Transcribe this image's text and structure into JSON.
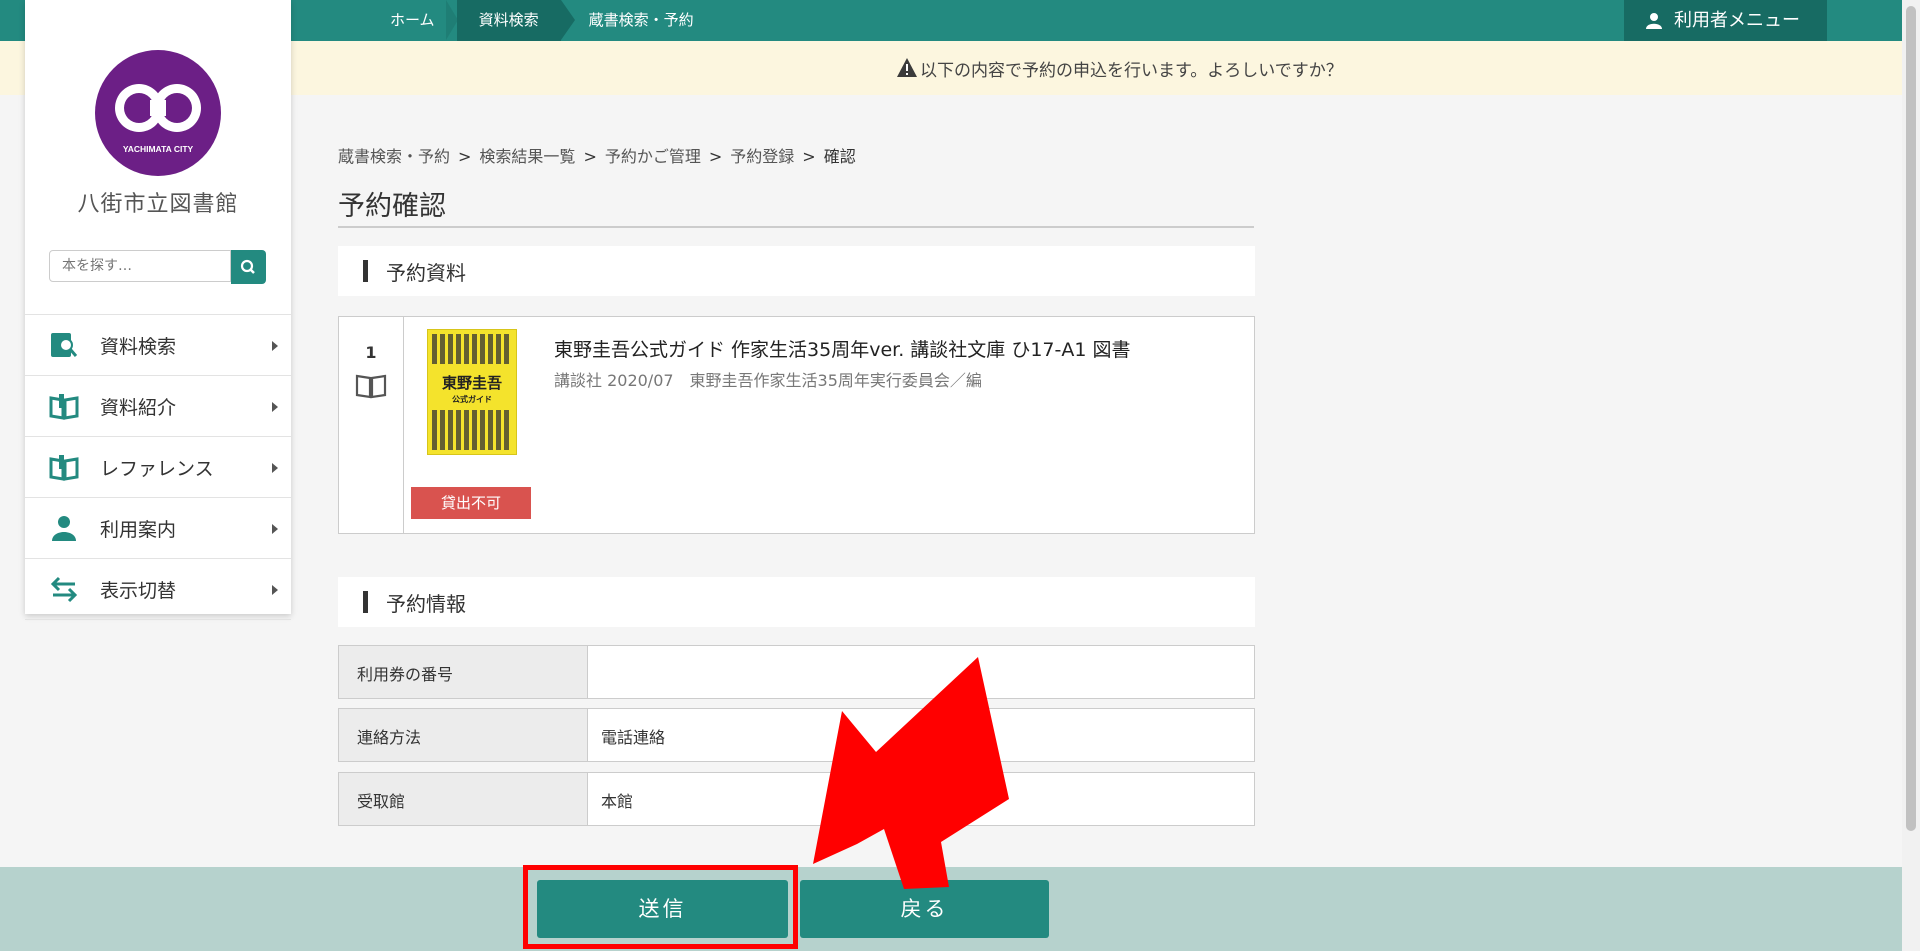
{
  "topnav": {
    "items": [
      "ホーム",
      "資料検索",
      "蔵書検索・予約"
    ],
    "user_menu": "利用者メニュー"
  },
  "warning": {
    "text": "以下の内容で予約の申込を行います。よろしいですか？"
  },
  "sidebar": {
    "logo_text": "YACHIMATA CITY",
    "library_name": "八街市立図書館",
    "search_placeholder": "本を探す…",
    "menu": [
      {
        "label": "資料検索",
        "icon": "book-search-icon"
      },
      {
        "label": "資料紹介",
        "icon": "open-book-icon"
      },
      {
        "label": "レファレンス",
        "icon": "open-book-icon"
      },
      {
        "label": "利用案内",
        "icon": "person-icon"
      },
      {
        "label": "表示切替",
        "icon": "swap-arrows-icon"
      }
    ]
  },
  "breadcrumb": {
    "items": [
      "蔵書検索・予約",
      "検索結果一覧",
      "予約かご管理",
      "予約登録"
    ],
    "current": "確認",
    "separator": ">"
  },
  "page_title": "予約確認",
  "reserved_section": {
    "heading": "予約資料",
    "item": {
      "number": "1",
      "title": "東野圭吾公式ガイド 作家生活35周年ver. 講談社文庫 ひ17-A1 図書",
      "meta": "講談社 2020/07　東野圭吾作家生活35周年実行委員会／編",
      "cover_title": "東野圭吾",
      "cover_subtitle": "公式ガイド",
      "status_badge": "貸出不可"
    }
  },
  "info_section": {
    "heading": "予約情報",
    "rows": [
      {
        "label": "利用券の番号",
        "value": ""
      },
      {
        "label": "連絡方法",
        "value": "電話連絡"
      },
      {
        "label": "受取館",
        "value": "本館"
      }
    ]
  },
  "buttons": {
    "submit": "送信",
    "back": "戻る"
  },
  "colors": {
    "brand": "#238a80",
    "brand_dark": "#176b63",
    "danger": "#d9534f",
    "highlight": "#ff0000",
    "logo": "#6c1f86"
  }
}
